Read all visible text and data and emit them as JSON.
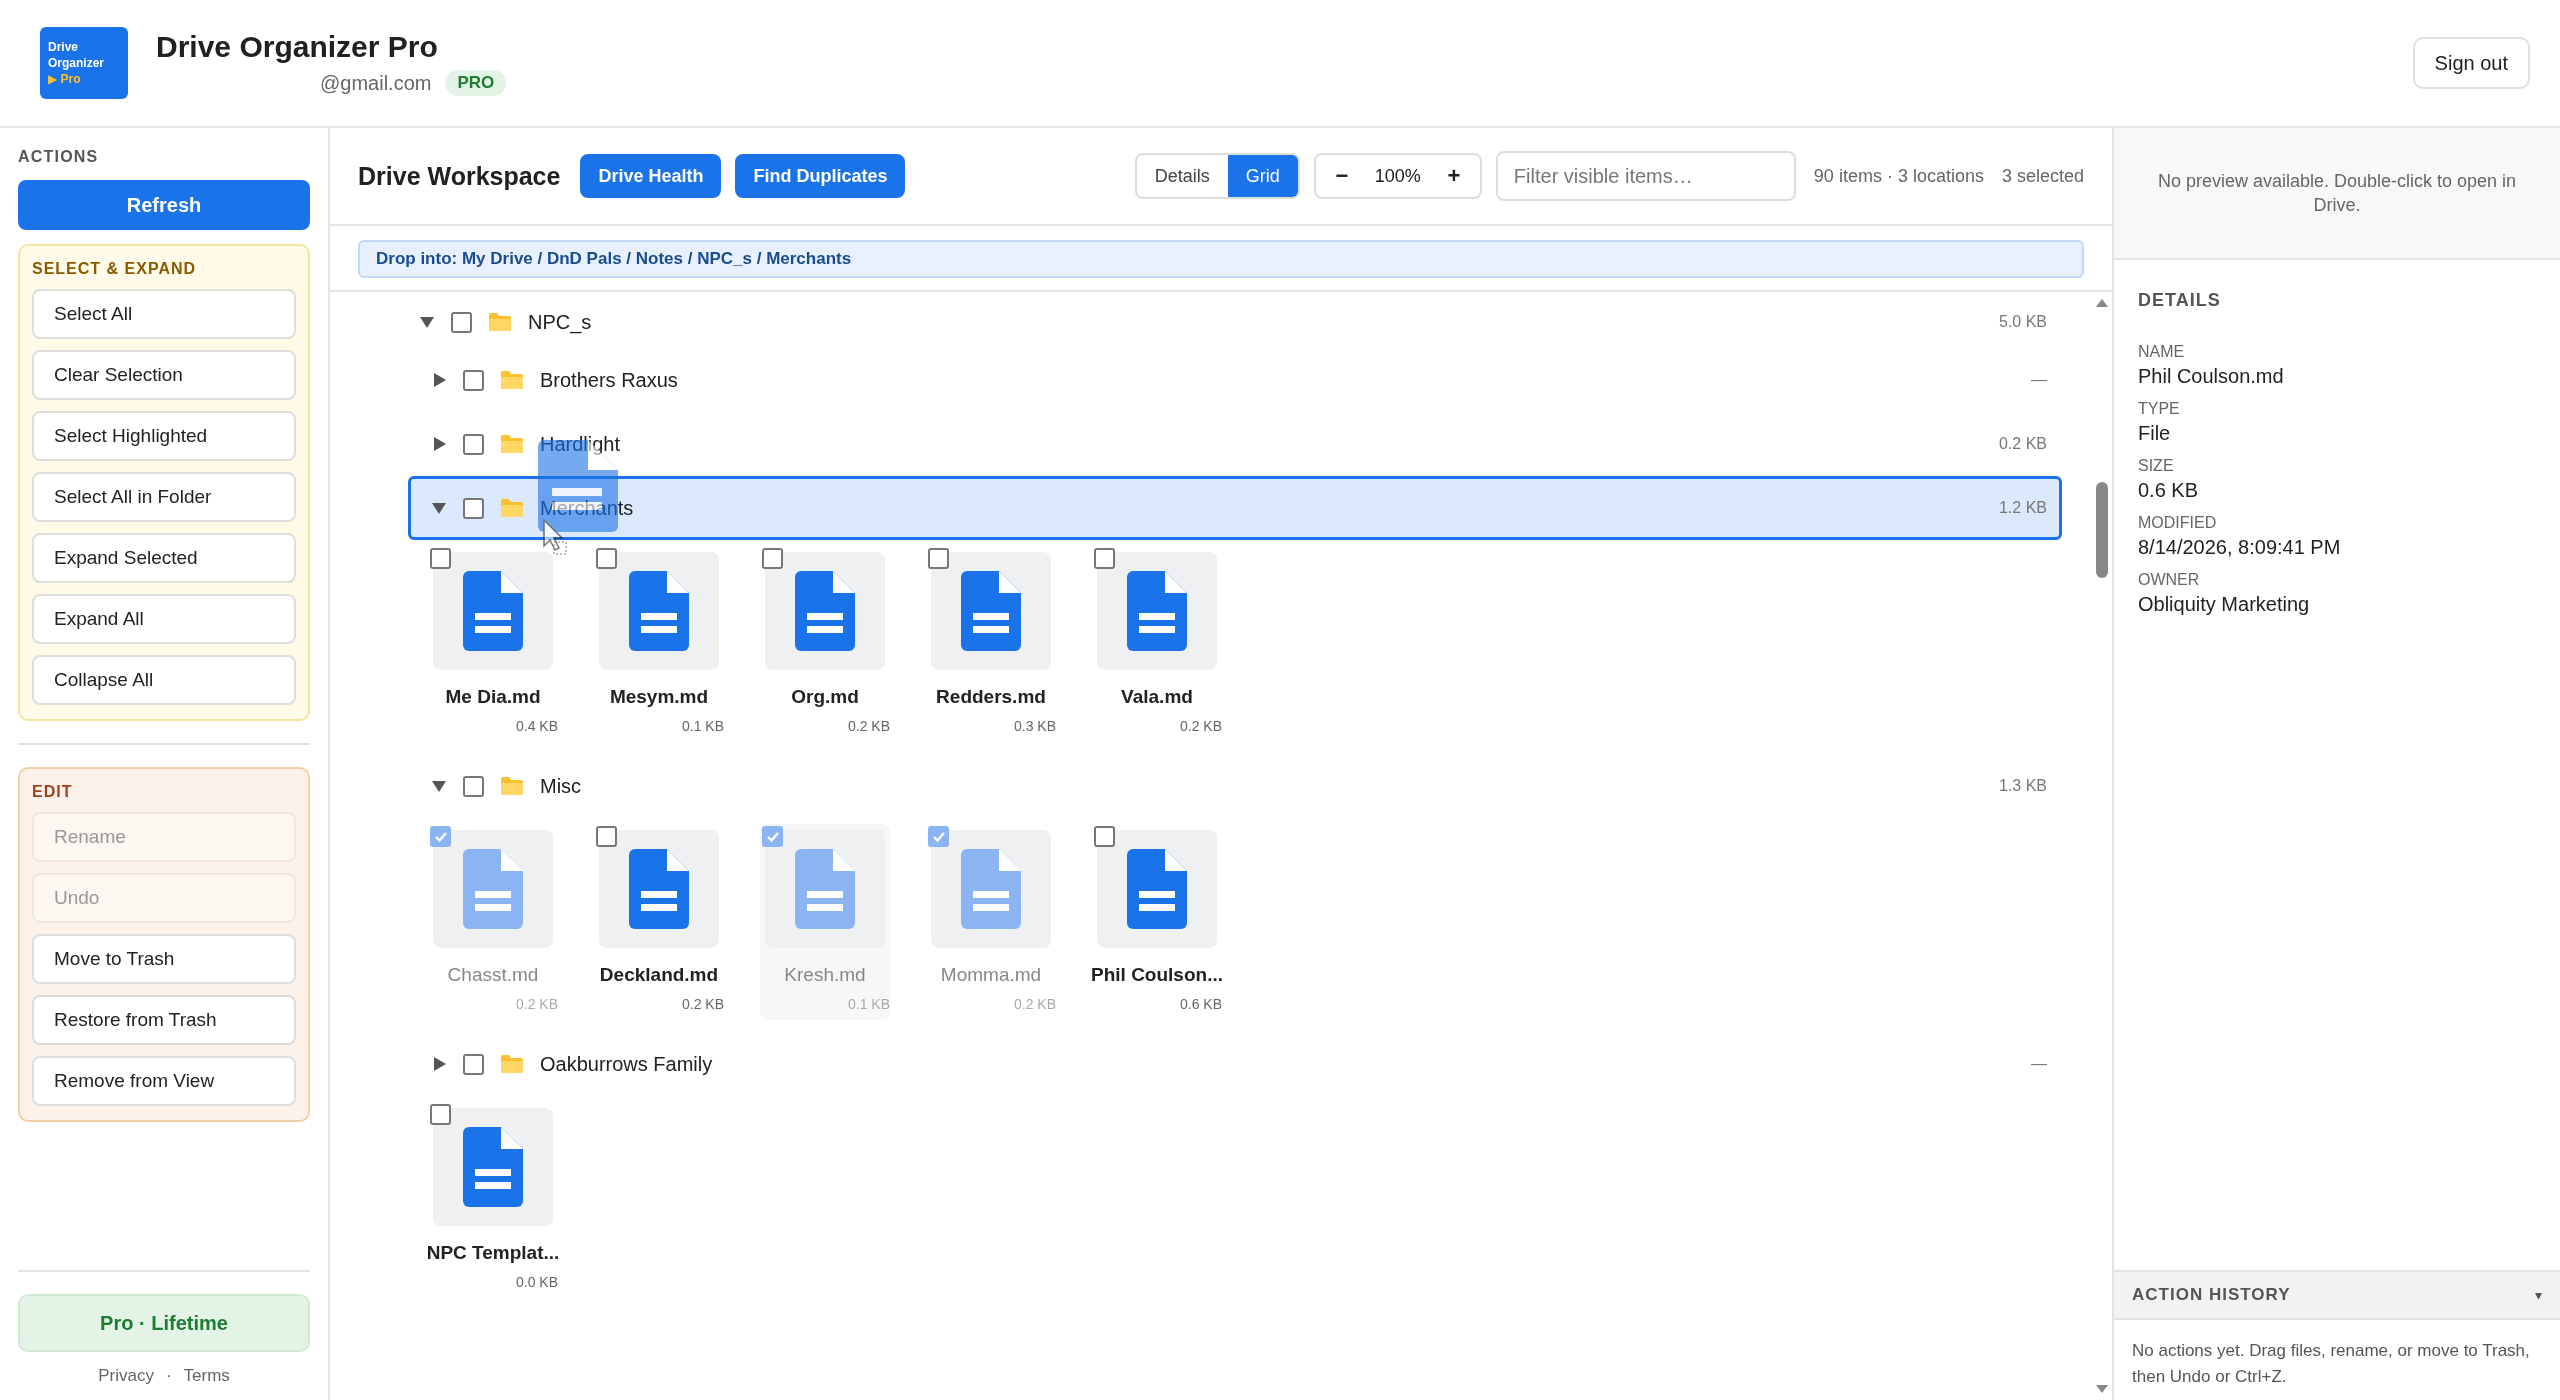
{
  "header": {
    "logo": {
      "line_1": "Drive",
      "line_2": "Organizer",
      "badge": "▶ Pro"
    },
    "title": "Drive Organizer Pro",
    "email": "@gmail.com",
    "plan": "PRO",
    "sign_out": "Sign out"
  },
  "sidebar": {
    "label": "ACTIONS",
    "refresh": "Refresh",
    "sections": [
      {
        "kind": "select",
        "title": "SELECT & EXPAND",
        "buttons": [
          {
            "label": "Select All",
            "disabled": false
          },
          {
            "label": "Clear Selection",
            "disabled": false
          },
          {
            "label": "Select Highlighted",
            "disabled": false
          },
          {
            "label": "Select All in Folder",
            "disabled": false
          },
          {
            "label": "Expand Selected",
            "disabled": false
          },
          {
            "label": "Expand All",
            "disabled": false
          },
          {
            "label": "Collapse All",
            "disabled": false
          }
        ]
      },
      {
        "kind": "edit",
        "title": "EDIT",
        "buttons": [
          {
            "label": "Rename",
            "disabled": true
          },
          {
            "label": "Undo",
            "disabled": true
          },
          {
            "label": "Move to Trash",
            "disabled": false
          },
          {
            "label": "Restore from Trash",
            "disabled": false
          },
          {
            "label": "Remove from View",
            "disabled": false
          }
        ]
      }
    ],
    "plan": "Pro · Lifetime",
    "links": [
      "Privacy",
      "Terms"
    ],
    "separator": "·"
  },
  "toolbar": {
    "title": "Drive Workspace",
    "buttons": [
      "Drive Health",
      "Find Duplicates"
    ],
    "views": [
      {
        "label": "Details",
        "selected": false
      },
      {
        "label": "Grid",
        "selected": true
      }
    ],
    "zoom": {
      "minus": "−",
      "value": "100%",
      "plus": "+"
    },
    "filter": {
      "placeholder": "Filter visible items…"
    },
    "stats": "90 items · 3 locations",
    "selected_count": "3 selected"
  },
  "breadcrumb": "Drop into: My Drive / DnD Pals / Notes / NPC_s / Merchants",
  "tree": [
    {
      "kind": "folder",
      "name": "NPC_s",
      "size": "5.0 KB",
      "expanded": true,
      "checked": false,
      "drop_target": false,
      "children": [
        {
          "kind": "folder",
          "name": "Brothers Raxus",
          "size": "—",
          "expanded": false,
          "checked": false,
          "drop_target": false
        },
        {
          "kind": "folder",
          "name": "Hardlight",
          "size": "0.2 KB",
          "expanded": false,
          "checked": false,
          "drop_target": false
        },
        {
          "kind": "folder",
          "name": "Merchants",
          "size": "1.2 KB",
          "expanded": true,
          "checked": false,
          "drop_target": true,
          "children": [
            {
              "kind": "file",
              "name": "Me Dia.md",
              "size": "0.4 KB",
              "checked": false,
              "highlighted": false
            },
            {
              "kind": "file",
              "name": "Mesym.md",
              "size": "0.1 KB",
              "checked": false,
              "highlighted": false
            },
            {
              "kind": "file",
              "name": "Org.md",
              "size": "0.2 KB",
              "checked": false,
              "highlighted": false
            },
            {
              "kind": "file",
              "name": "Redders.md",
              "size": "0.3 KB",
              "checked": false,
              "highlighted": false
            },
            {
              "kind": "file",
              "name": "Vala.md",
              "size": "0.2 KB",
              "checked": false,
              "highlighted": false
            }
          ]
        },
        {
          "kind": "folder",
          "name": "Misc",
          "size": "1.3 KB",
          "expanded": true,
          "checked": false,
          "drop_target": false,
          "children": [
            {
              "kind": "file",
              "name": "Chasst.md",
              "size": "0.2 KB",
              "checked": true,
              "highlighted": false
            },
            {
              "kind": "file",
              "name": "Deckland.md",
              "size": "0.2 KB",
              "checked": false,
              "highlighted": false
            },
            {
              "kind": "file",
              "name": "Kresh.md",
              "size": "0.1 KB",
              "checked": true,
              "highlighted": true
            },
            {
              "kind": "file",
              "name": "Momma.md",
              "size": "0.2 KB",
              "checked": true,
              "highlighted": false
            },
            {
              "kind": "file",
              "name": "Phil Coulson...",
              "size": "0.6 KB",
              "checked": false,
              "highlighted": false
            }
          ]
        },
        {
          "kind": "folder",
          "name": "Oakburrows Family",
          "size": "—",
          "expanded": false,
          "checked": false,
          "drop_target": false
        },
        {
          "kind": "file",
          "name": "NPC Templat...",
          "size": "0.0 KB",
          "checked": false,
          "highlighted": false
        }
      ]
    }
  ],
  "details_panel": {
    "preview": "No preview available. Double-click to open in Drive.",
    "title": "DETAILS",
    "fields": [
      {
        "label": "NAME",
        "value": "Phil Coulson.md"
      },
      {
        "label": "TYPE",
        "value": "File"
      },
      {
        "label": "SIZE",
        "value": "0.6 KB"
      },
      {
        "label": "MODIFIED",
        "value": "8/14/2026, 8:09:41 PM"
      },
      {
        "label": "OWNER",
        "value": "Obliquity Marketing"
      }
    ],
    "history": {
      "title": "ACTION HISTORY",
      "caret": "▾",
      "text": "No actions yet. Drag files, rename, or move to Trash, then Undo or Ctrl+Z."
    }
  }
}
